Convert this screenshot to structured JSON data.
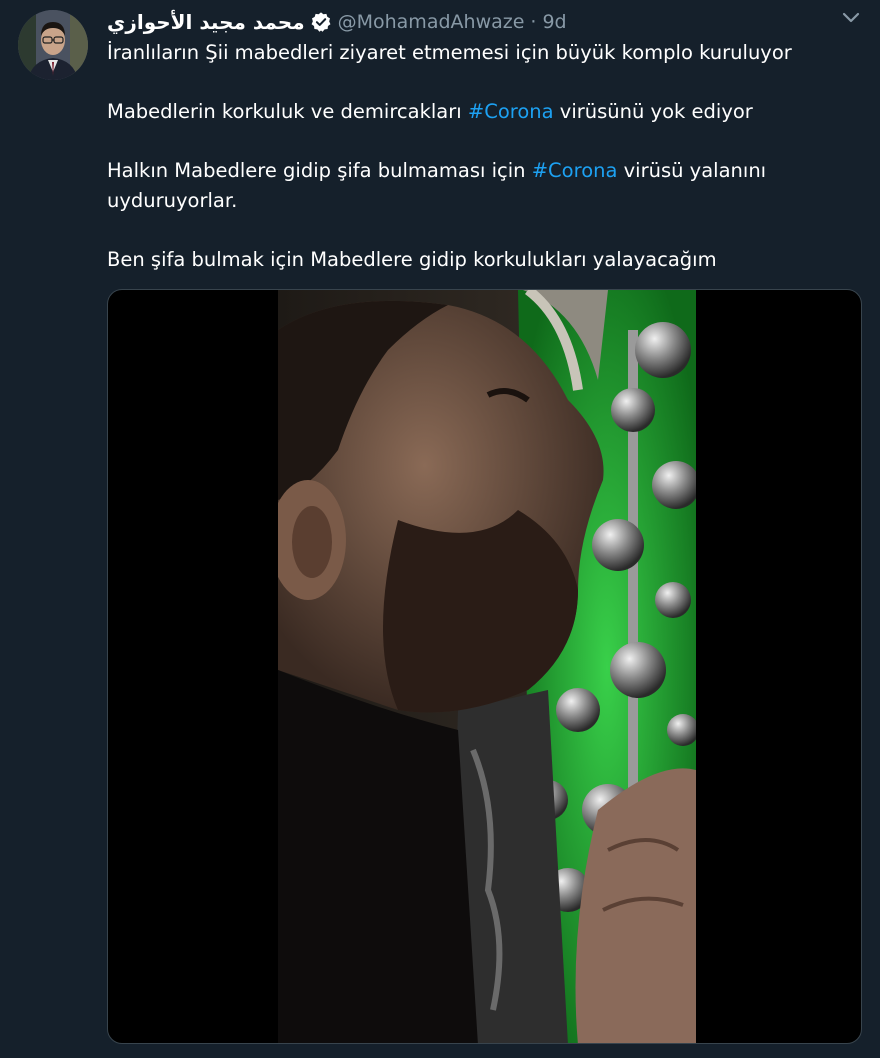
{
  "tweet": {
    "author": {
      "display_name": "محمد مجيد الأحوازي",
      "handle": "@MohamadAhwaze",
      "verified": true,
      "avatar_icon": "profile-photo"
    },
    "separator": "·",
    "time": "9d",
    "menu_icon": "chevron-down-icon",
    "text": {
      "line1": "İranlıların Şii mabedleri ziyaret etmemesi için büyük komplo kuruluyor",
      "line2_a": "Mabedlerin korkuluk ve demircakları ",
      "line2_tag": "#Corona",
      "line2_b": " virüsünü yok ediyor",
      "line3_a": "Halkın Mabedlere gidip şifa bulmaması için ",
      "line3_tag": "#Corona",
      "line3_b": " virüsü yalanını uyduruyorlar.",
      "line4": "Ben şifa bulmak için Mabedlere gidip korkulukları yalayacağım"
    },
    "media": {
      "type": "video",
      "icon": "video-frame"
    }
  },
  "colors": {
    "background": "#15202b",
    "text": "#ffffff",
    "secondary": "#8899a6",
    "hashtag": "#1da1f2",
    "verified": "#ffffff"
  }
}
